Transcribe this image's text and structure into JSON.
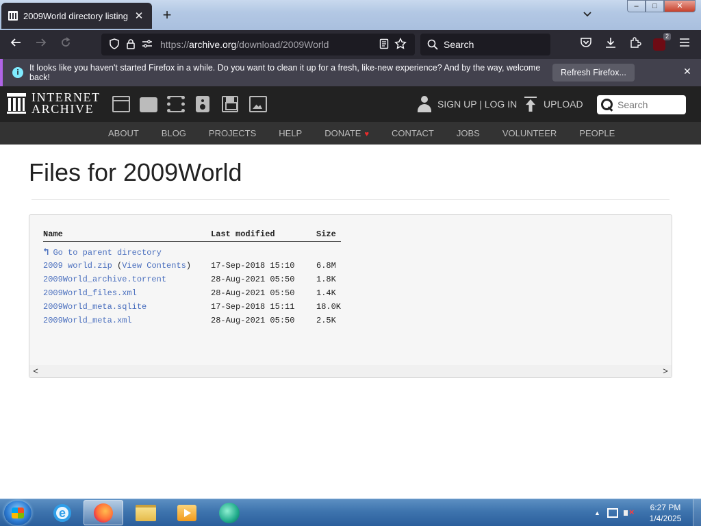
{
  "browser": {
    "tab_title": "2009World directory listing",
    "tab_close": "✕",
    "new_tab": "+",
    "tab_list": "⌄",
    "window_controls": {
      "minimize": "–",
      "maximize": "□",
      "close": "✕"
    },
    "url_prefix": "https://",
    "url_host": "archive.org",
    "url_path": "/download/2009World",
    "search_placeholder": "Search",
    "extension_badge": "2",
    "icons": [
      "back-arrow",
      "forward-arrow",
      "reload",
      "shield",
      "lock",
      "permissions",
      "reader-view",
      "bookmark-star",
      "pocket",
      "downloads",
      "extensions",
      "ublock",
      "menu"
    ]
  },
  "notification": {
    "message": "It looks like you haven't started Firefox in a while. Do you want to clean it up for a fresh, like-new experience? And by the way, welcome back!",
    "button_label": "Refresh Firefox...",
    "close": "✕"
  },
  "ia_header": {
    "logo_line1": "INTERNET",
    "logo_line2": "ARCHIVE",
    "signup_login": "SIGN UP | LOG IN",
    "upload": "UPLOAD",
    "search_placeholder": "Search",
    "nav_items": [
      "ABOUT",
      "BLOG",
      "PROJECTS",
      "HELP",
      "DONATE",
      "CONTACT",
      "JOBS",
      "VOLUNTEER",
      "PEOPLE"
    ],
    "donate_heart": "♥",
    "colors": {
      "header_bg": "#222222",
      "nav_bg": "#333333",
      "heart": "#ec2c2c"
    }
  },
  "page": {
    "title": "Files for 2009World",
    "table": {
      "headers": [
        "Name",
        "Last modified",
        "Size"
      ],
      "parent_link": "Go to parent directory",
      "rows": [
        {
          "name": "2009 world.zip",
          "extra_open": " (",
          "extra_link": "View Contents",
          "extra_close": ")",
          "modified": "17-Sep-2018 15:10",
          "size": "6.8M"
        },
        {
          "name": "2009World_archive.torrent",
          "modified": "28-Aug-2021 05:50",
          "size": "1.8K"
        },
        {
          "name": "2009World_files.xml",
          "modified": "28-Aug-2021 05:50",
          "size": "1.4K"
        },
        {
          "name": "2009World_meta.sqlite",
          "modified": "17-Sep-2018 15:11",
          "size": "18.0K"
        },
        {
          "name": "2009World_meta.xml",
          "modified": "28-Aug-2021 05:50",
          "size": "2.5K"
        }
      ]
    },
    "scroll_left": "<",
    "scroll_right": ">",
    "link_color": "#4a6fbe"
  },
  "taskbar": {
    "apps": [
      "internet-explorer",
      "firefox",
      "file-explorer",
      "media-player",
      "app"
    ],
    "active_app": "firefox",
    "clock_time": "6:27 PM",
    "clock_date": "1/4/2025",
    "tray_arrow": "▲"
  }
}
